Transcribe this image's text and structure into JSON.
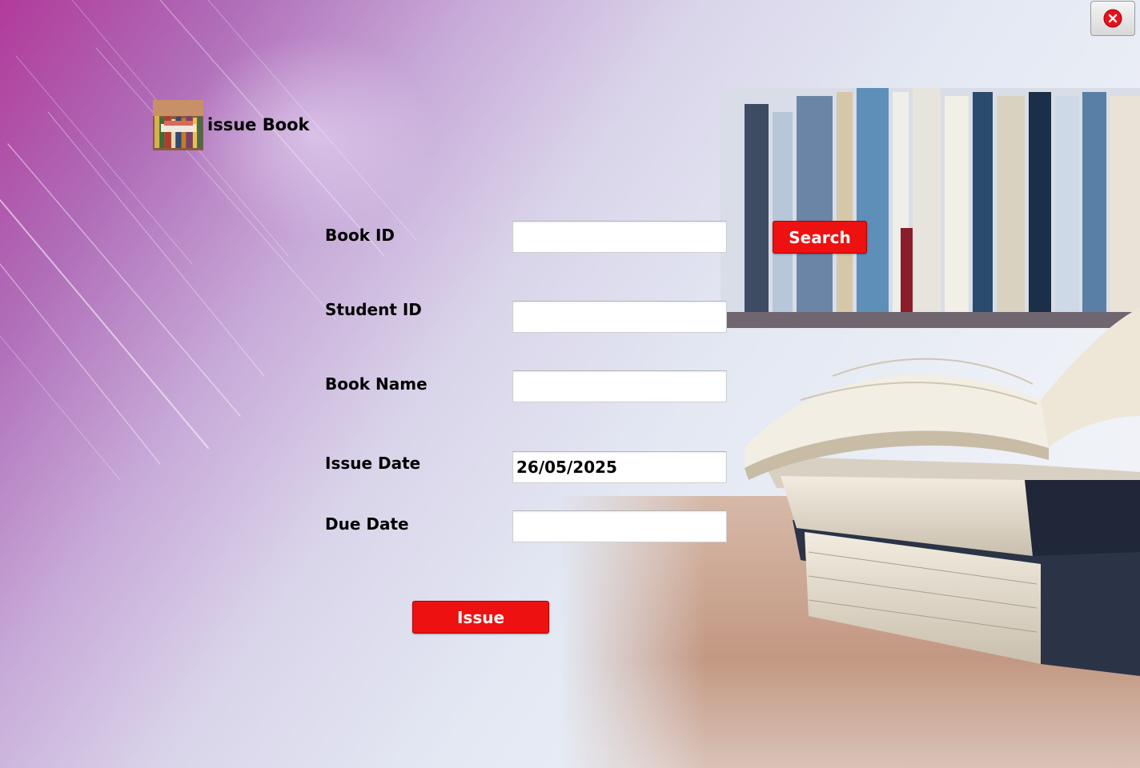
{
  "window": {
    "title": "issue Book",
    "close_icon": "close-icon",
    "header_icon": "library-books-icon"
  },
  "form": {
    "book_id": {
      "label": "Book ID",
      "value": ""
    },
    "student_id": {
      "label": "Student ID",
      "value": ""
    },
    "book_name": {
      "label": "Book Name",
      "value": ""
    },
    "issue_date": {
      "label": "Issue Date",
      "value": "26/05/2025"
    },
    "due_date": {
      "label": "Due Date",
      "value": ""
    }
  },
  "buttons": {
    "search_label": "Search",
    "issue_label": "Issue"
  },
  "colors": {
    "accent": "#ee1111",
    "background_start": "#b13a9a",
    "background_end": "#f3f4f8"
  }
}
